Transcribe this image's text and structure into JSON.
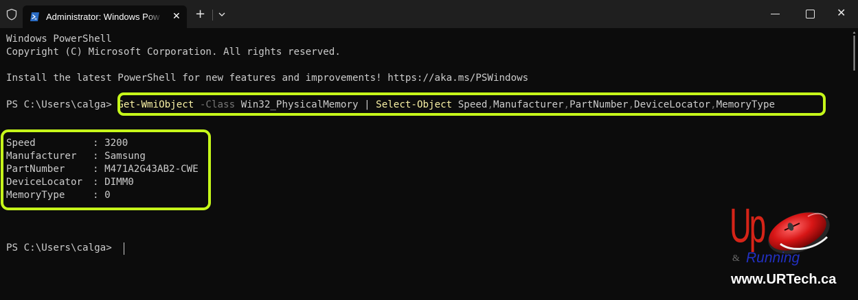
{
  "window": {
    "tab_title": "Administrator: Windows PowerShell",
    "new_tab_symbol": "+",
    "close_tab_symbol": "✕",
    "close_window_symbol": "✕",
    "icons": [
      "shield-icon",
      "powershell-icon",
      "chevron-down-icon",
      "minimize-icon",
      "maximize-icon",
      "close-icon"
    ]
  },
  "terminal": {
    "banner_title": "Windows PowerShell",
    "copyright": "Copyright (C) Microsoft Corporation. All rights reserved.",
    "install_tip": "Install the latest PowerShell for new features and improvements! https://aka.ms/PSWindows",
    "prompt": "PS C:\\Users\\calga>",
    "command": {
      "cmdlet1": "Get-WmiObject",
      "param": "-Class",
      "arg": "Win32_PhysicalMemory",
      "pipe": "|",
      "cmdlet2": "Select-Object",
      "fields": [
        "Speed",
        "Manufacturer",
        "PartNumber",
        "DeviceLocator",
        "MemoryType"
      ],
      "separator": ","
    },
    "output": [
      {
        "name": "Speed",
        "value": "3200"
      },
      {
        "name": "Manufacturer",
        "value": "Samsung"
      },
      {
        "name": "PartNumber",
        "value": "M471A2G43AB2-CWE"
      },
      {
        "name": "DeviceLocator",
        "value": "DIMM0"
      },
      {
        "name": "MemoryType",
        "value": "0"
      }
    ],
    "output_separator": ": ",
    "final_prompt": "PS C:\\Users\\calga>"
  },
  "colors": {
    "background": "#0c0c0c",
    "text": "#cccccc",
    "cmdlet": "#f9f1a5",
    "parameter": "#767676",
    "highlight": "#c6f81a"
  },
  "watermark": {
    "logo_up": "Up",
    "logo_amp": "&",
    "logo_running": "Running",
    "url": "www.URTech.ca"
  }
}
